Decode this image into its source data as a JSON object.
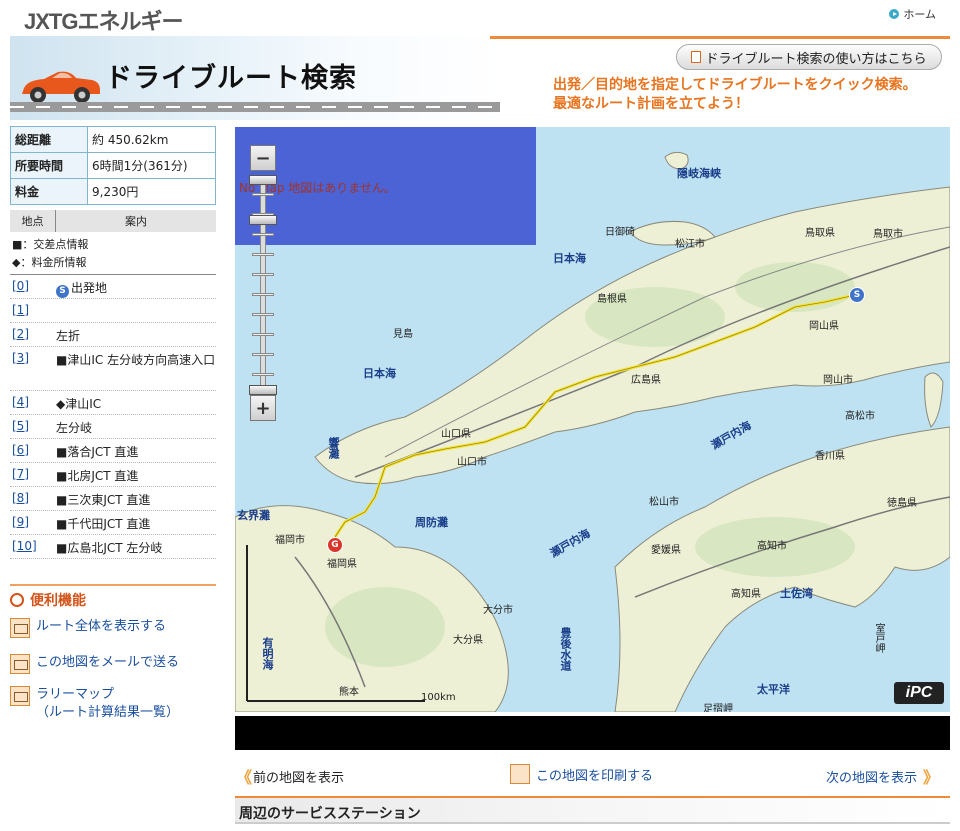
{
  "topbar": {
    "logo": "JXTGエネルギー",
    "home_label": "ホーム"
  },
  "header": {
    "title": "ドライブルート検索",
    "howto_button": "ドライブルート検索の使い方はこちら",
    "tagline_line1": "出発／目的地を指定してドライブルートをクイック検索。",
    "tagline_line2": "最適なルート計画を立てよう！"
  },
  "summary": {
    "distance_label": "総距離",
    "distance_value": "約 450.62km",
    "time_label": "所要時間",
    "time_value": "6時間1分(361分)",
    "toll_label": "料金",
    "toll_value": "9,230円"
  },
  "route_table": {
    "col_point": "地点",
    "col_guide": "案内",
    "legend_intersection": "■：交差点情報",
    "legend_toll": "◆：料金所情報",
    "start_badge": "S",
    "steps": [
      {
        "num": "[0]",
        "text": "出発地"
      },
      {
        "num": "[1]",
        "text": ""
      },
      {
        "num": "[2]",
        "text": "左折"
      },
      {
        "num": "[3]",
        "text": "■津山IC 左分岐方向高速入口"
      },
      {
        "num": "[4]",
        "text": "◆津山IC"
      },
      {
        "num": "[5]",
        "text": "左分岐"
      },
      {
        "num": "[6]",
        "text": "■落合JCT 直進"
      },
      {
        "num": "[7]",
        "text": "■北房JCT 直進"
      },
      {
        "num": "[8]",
        "text": "■三次東JCT 直進"
      },
      {
        "num": "[9]",
        "text": "■千代田JCT 直進"
      },
      {
        "num": "[10]",
        "text": "■広島北JCT 左分岐"
      }
    ]
  },
  "convenience": {
    "title": "便利機能",
    "show_whole_route": "ルート全体を表示する",
    "email_map": "この地図をメールで送る",
    "rally_map_line1": "ラリーマップ",
    "rally_map_line2": "（ルート計算結果一覧）"
  },
  "map": {
    "nomap_text": "No Map 地図はありません。",
    "zoom_in": "+",
    "zoom_out": "−",
    "scale_label": "100km",
    "logo": "iPC",
    "start_marker": "S",
    "goal_marker": "G",
    "labels": [
      {
        "text": "隠岐海峡",
        "kind": "sea"
      },
      {
        "text": "日本海",
        "kind": "sea"
      },
      {
        "text": "日本海",
        "kind": "sea"
      },
      {
        "text": "響灘",
        "kind": "sea"
      },
      {
        "text": "玄界灘",
        "kind": "sea"
      },
      {
        "text": "周防灘",
        "kind": "sea"
      },
      {
        "text": "瀬戸内海",
        "kind": "sea"
      },
      {
        "text": "瀬戸内海",
        "kind": "sea"
      },
      {
        "text": "豊後水道",
        "kind": "sea"
      },
      {
        "text": "有明海",
        "kind": "sea"
      },
      {
        "text": "土佐湾",
        "kind": "sea"
      },
      {
        "text": "太平洋",
        "kind": "sea"
      },
      {
        "text": "日御碕",
        "kind": "land"
      },
      {
        "text": "松江市",
        "kind": "land"
      },
      {
        "text": "鳥取県",
        "kind": "land"
      },
      {
        "text": "鳥取市",
        "kind": "land"
      },
      {
        "text": "島根県",
        "kind": "land"
      },
      {
        "text": "岡山県",
        "kind": "land"
      },
      {
        "text": "岡山市",
        "kind": "land"
      },
      {
        "text": "見島",
        "kind": "land"
      },
      {
        "text": "広島県",
        "kind": "land"
      },
      {
        "text": "山口県",
        "kind": "land"
      },
      {
        "text": "山口市",
        "kind": "land"
      },
      {
        "text": "福岡市",
        "kind": "land"
      },
      {
        "text": "福岡県",
        "kind": "land"
      },
      {
        "text": "高松市",
        "kind": "land"
      },
      {
        "text": "香川県",
        "kind": "land"
      },
      {
        "text": "徳島県",
        "kind": "land"
      },
      {
        "text": "松山市",
        "kind": "land"
      },
      {
        "text": "愛媛県",
        "kind": "land"
      },
      {
        "text": "高知市",
        "kind": "land"
      },
      {
        "text": "高知県",
        "kind": "land"
      },
      {
        "text": "大分市",
        "kind": "land"
      },
      {
        "text": "大分県",
        "kind": "land"
      },
      {
        "text": "熊本",
        "kind": "land"
      },
      {
        "text": "室戸岬",
        "kind": "land"
      },
      {
        "text": "足摺岬",
        "kind": "land"
      }
    ]
  },
  "map_nav": {
    "prev": "前の地図を表示",
    "print": "この地図を印刷する",
    "next": "次の地図を表示"
  },
  "service_station": {
    "title": "周辺のサービスステーション"
  },
  "colors": {
    "accent_orange": "#f08a3b",
    "link_blue": "#1a4fa0",
    "route_yellow": "#f3e23a"
  }
}
